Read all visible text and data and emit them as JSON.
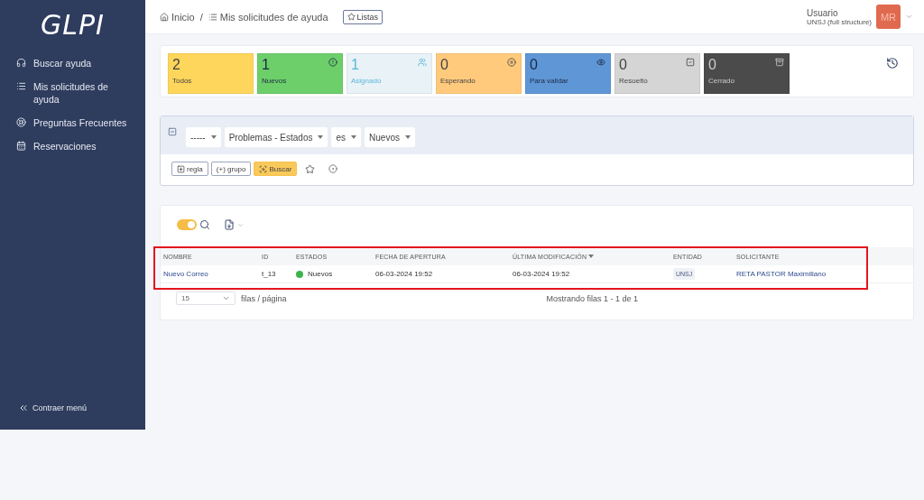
{
  "sidebar": {
    "logo": "GLPI",
    "items": [
      {
        "label": "Buscar ayuda",
        "selected": false
      },
      {
        "label": "Mis solicitudes de ayuda",
        "selected": false
      },
      {
        "label": "Preguntas Frecuentes",
        "selected": false
      },
      {
        "label": "Reservaciones",
        "selected": false
      }
    ],
    "collapse": "Contraer menú"
  },
  "header": {
    "breadcrumbs": [
      {
        "label": "Inicio"
      },
      {
        "label": "Mis solicitudes de ayuda"
      }
    ],
    "separator": "/",
    "lists_button": "Listas",
    "user": {
      "name": "Usuario",
      "entity": "UNSJ (full structure)",
      "initials": "MR"
    }
  },
  "stats": [
    {
      "count": "2",
      "label": "Todos",
      "color": "#ffd65c"
    },
    {
      "count": "1",
      "label": "Nuevos",
      "color": "#6ccf6a"
    },
    {
      "count": "1",
      "label": "Asignado",
      "color": "#e8f2f7"
    },
    {
      "count": "0",
      "label": "Esperando",
      "color": "#ffca7c"
    },
    {
      "count": "0",
      "label": "Para validar",
      "color": "#5e96d6"
    },
    {
      "count": "0",
      "label": "Resuelto",
      "color": "#d5d5d5"
    },
    {
      "count": "0",
      "label": "Cerrado",
      "color": "#4b4b4b"
    }
  ],
  "filter": {
    "criteria": [
      {
        "value": "-----"
      },
      {
        "value": "Problemas - Estados"
      },
      {
        "value": "es"
      },
      {
        "value": "Nuevos"
      }
    ],
    "buttons": [
      {
        "label": "regla",
        "kind": "rule"
      },
      {
        "label": "(+) grupo",
        "kind": "group"
      },
      {
        "label": "Buscar",
        "kind": "search"
      }
    ]
  },
  "results": {
    "toggle_on": true,
    "table": {
      "columns": [
        {
          "label": "NOMBRE",
          "sorted": false
        },
        {
          "label": "ID",
          "sorted": false
        },
        {
          "label": "ESTADOS",
          "sorted": false
        },
        {
          "label": "FECHA DE APERTURA",
          "sorted": false
        },
        {
          "label": "ÚLTIMA MODIFICACIÓN",
          "sorted": true
        },
        {
          "label": "ENTIDAD",
          "sorted": false
        },
        {
          "label": "SOLICITANTE",
          "sorted": false
        }
      ],
      "rows": [
        {
          "name": "Nuevo Correo",
          "id": "t_13",
          "status": "Nuevos",
          "color": "#3cb44b",
          "opened": "06-03-2024 19:52",
          "modified": "06-03-2024 19:52",
          "entity": "UNSJ",
          "requester": "RETA PASTOR Maximiliano"
        }
      ]
    },
    "page_size": "15",
    "page_size_label": "filas / página",
    "summary": "Mostrando filas 1 - 1 de 1",
    "highlighted": true
  }
}
